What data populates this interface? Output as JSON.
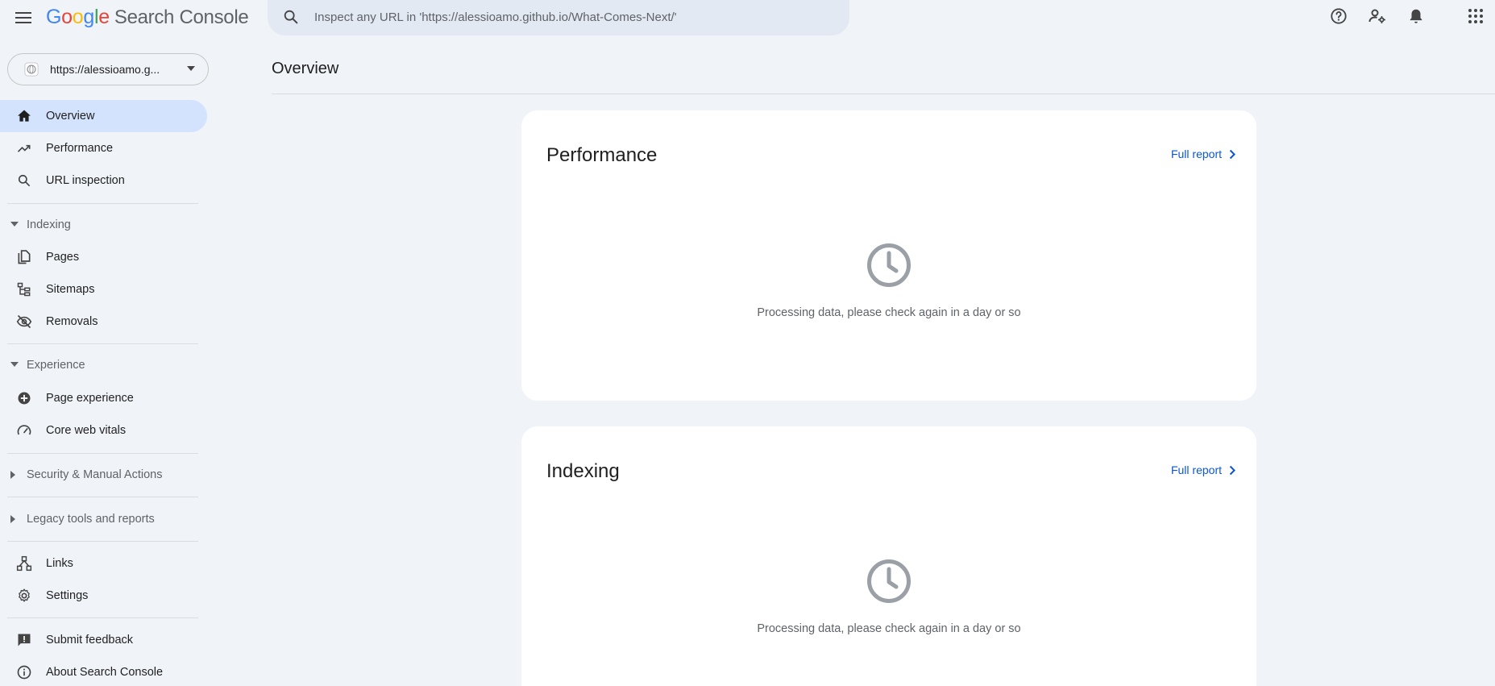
{
  "app": {
    "logo_letters": [
      "G",
      "o",
      "o",
      "g",
      "l",
      "e"
    ],
    "product_name": "Search Console"
  },
  "search": {
    "placeholder": "Inspect any URL in 'https://alessioamo.github.io/What-Comes-Next/'"
  },
  "top_icons": [
    "help-icon",
    "manage-users-icon",
    "notifications-icon",
    "apps-grid-icon"
  ],
  "property": {
    "label": "https://alessioamo.g..."
  },
  "sidebar": {
    "overview": "Overview",
    "performance": "Performance",
    "url_inspection": "URL inspection",
    "indexing_section": "Indexing",
    "pages": "Pages",
    "sitemaps": "Sitemaps",
    "removals": "Removals",
    "experience_section": "Experience",
    "page_experience": "Page experience",
    "core_web_vitals": "Core web vitals",
    "security_section": "Security & Manual Actions",
    "legacy_section": "Legacy tools and reports",
    "links": "Links",
    "settings": "Settings",
    "submit_feedback": "Submit feedback",
    "about": "About Search Console"
  },
  "main": {
    "title": "Overview",
    "cards": [
      {
        "title": "Performance",
        "link": "Full report",
        "message": "Processing data, please check again in a day or so"
      },
      {
        "title": "Indexing",
        "link": "Full report",
        "message": "Processing data, please check again in a day or so"
      }
    ]
  },
  "colors": {
    "background": "#f0f4f9",
    "active_nav": "#d3e3fd",
    "link": "#0b57d0",
    "card": "#ffffff"
  }
}
